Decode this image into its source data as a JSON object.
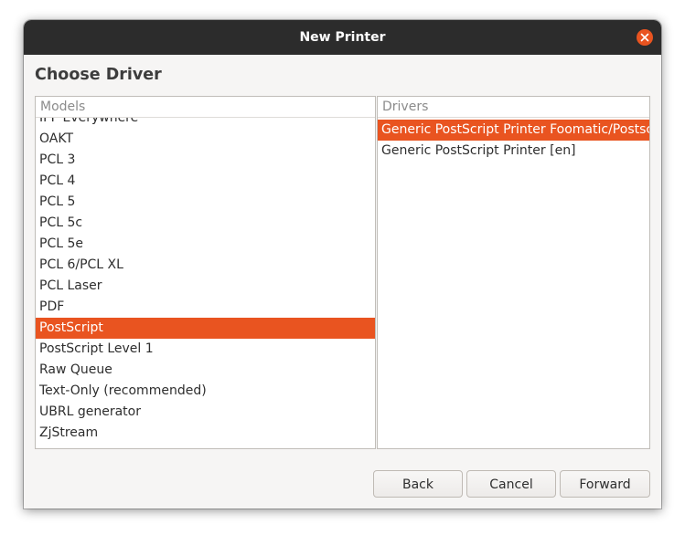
{
  "window": {
    "title": "New Printer"
  },
  "page": {
    "heading": "Choose Driver"
  },
  "models": {
    "header": "Models",
    "items": [
      "IPP Everywhere",
      "OAKT",
      "PCL 3",
      "PCL 4",
      "PCL 5",
      "PCL 5c",
      "PCL 5e",
      "PCL 6/PCL XL",
      "PCL Laser",
      "PDF",
      "PostScript",
      "PostScript Level 1",
      "Raw Queue",
      "Text-Only (recommended)",
      "UBRL generator",
      "ZjStream"
    ],
    "selected": "PostScript"
  },
  "drivers": {
    "header": "Drivers",
    "items": [
      "Generic PostScript Printer Foomatic/Postscript [en] (recommended)",
      "Generic PostScript Printer [en]"
    ],
    "selected": "Generic PostScript Printer Foomatic/Postscript [en] (recommended)"
  },
  "buttons": {
    "back": "Back",
    "cancel": "Cancel",
    "forward": "Forward"
  },
  "colors": {
    "accent": "#e95420",
    "titlebar": "#2c2c2c",
    "window_bg": "#f6f5f4"
  },
  "icons": {
    "close": "close-icon"
  }
}
